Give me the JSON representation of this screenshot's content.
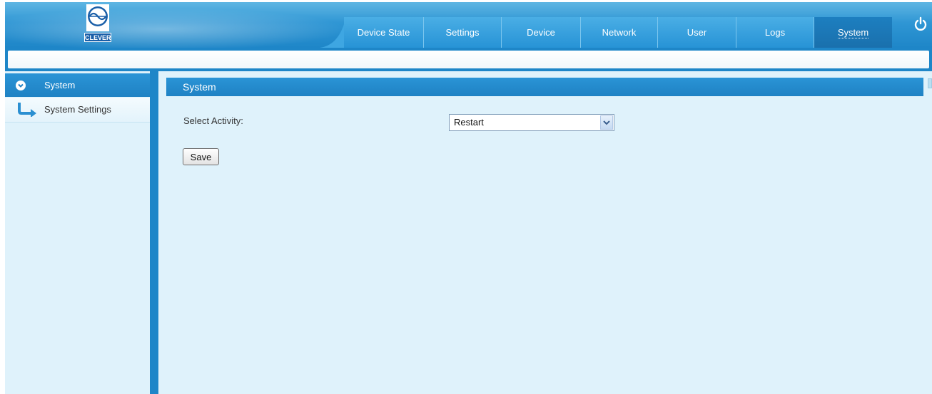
{
  "header": {
    "logo_text": "CLEVER",
    "tabs": [
      {
        "label": "Device State"
      },
      {
        "label": "Settings"
      },
      {
        "label": "Device"
      },
      {
        "label": "Network"
      },
      {
        "label": "User"
      },
      {
        "label": "Logs"
      },
      {
        "label": "System",
        "active": true
      }
    ],
    "power_icon": "power-icon"
  },
  "sidebar": {
    "section_label": "System",
    "items": [
      {
        "label": "System Settings",
        "icon": "arrow-right-icon"
      }
    ]
  },
  "main": {
    "title": "System",
    "field_label": "Select Activity:",
    "select_value": "Restart",
    "save_label": "Save"
  },
  "colors": {
    "header_blue": "#2f96d4",
    "panel_bg": "#dff2fb",
    "title_bar": "#1f82c4"
  }
}
